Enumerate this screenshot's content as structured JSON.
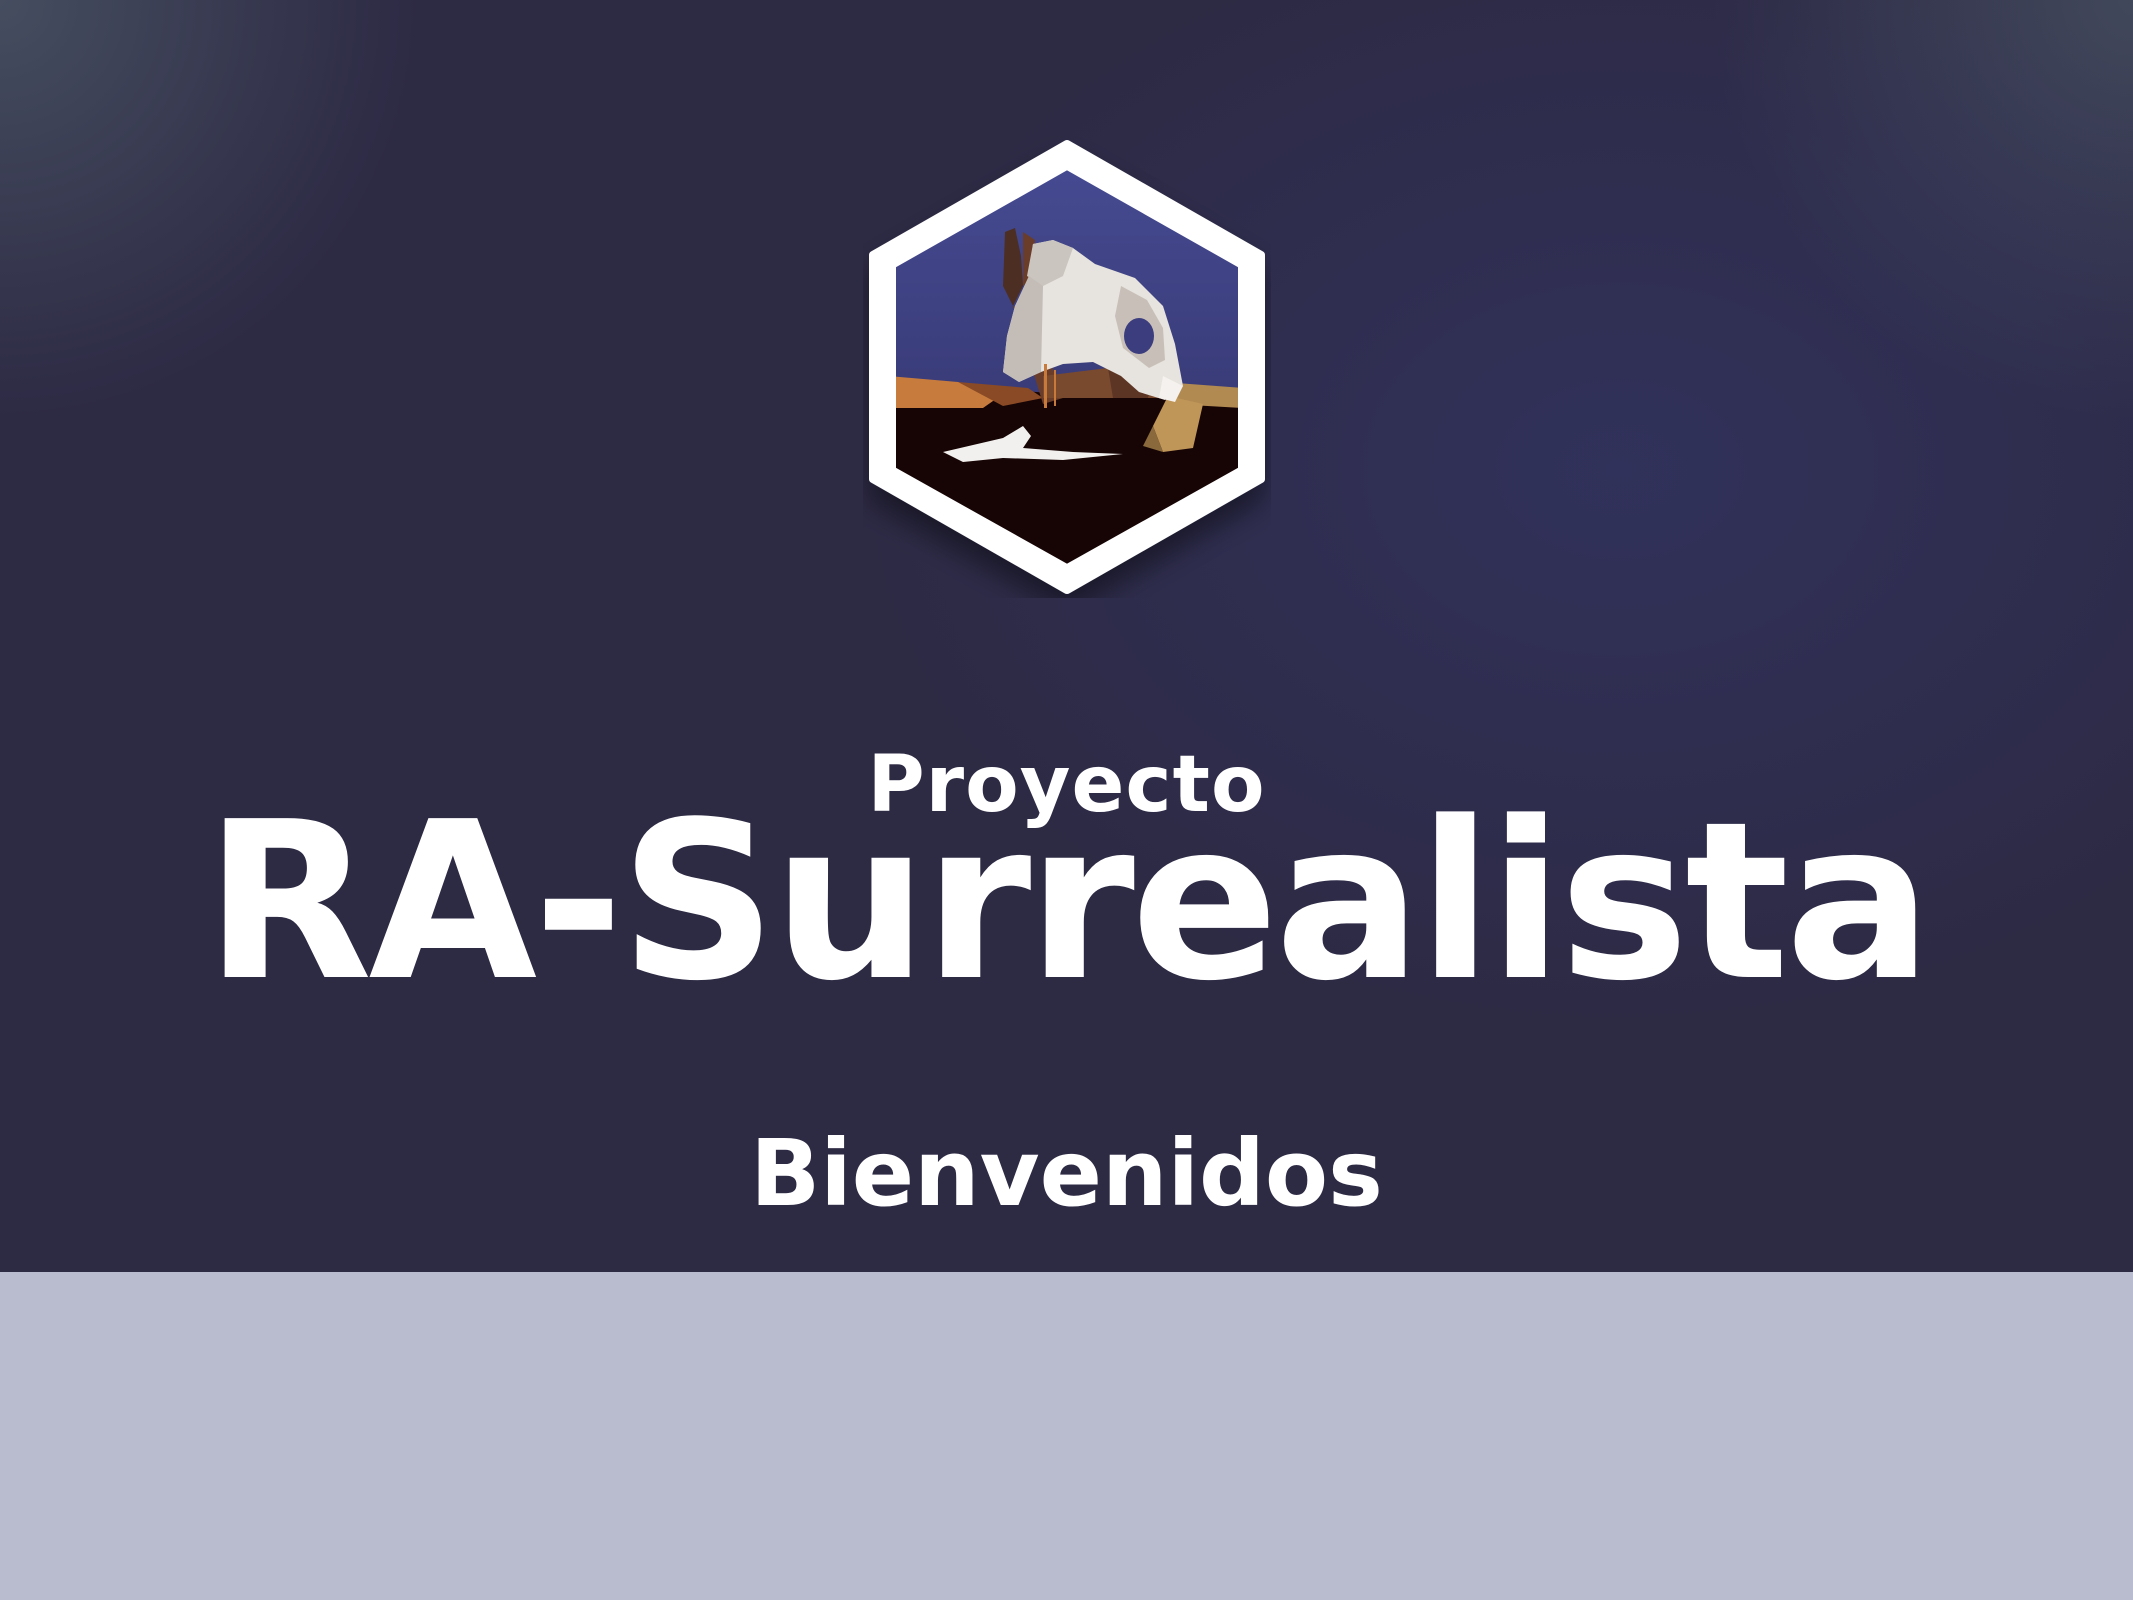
{
  "slide": {
    "kicker": "Proyecto",
    "title": "RA-Surrealista",
    "welcome": "Bienvenidos"
  },
  "badge": {
    "icon": "surrealist-melting-clock-icon"
  },
  "colors": {
    "background": "#2d2a44",
    "footer_band": "#b9bbcf",
    "text": "#ffffff",
    "sky": "#3c3d7e",
    "ground": "#1a0808",
    "sand": "#c87a3a"
  }
}
